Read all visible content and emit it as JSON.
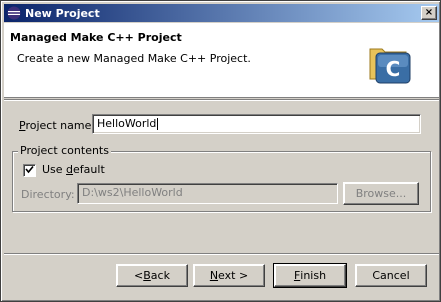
{
  "window": {
    "title": "New Project",
    "close_glyph": "×"
  },
  "header": {
    "title": "Managed Make C++ Project",
    "description": "Create a new Managed Make C++ Project.",
    "icon_letter": "C"
  },
  "form": {
    "project_name_label_u": "P",
    "project_name_label_rest": "roject name:",
    "project_name_value": "HelloWorld",
    "group_title": "Project contents",
    "use_default_checked": true,
    "use_default_label_pre": "Use ",
    "use_default_label_u": "d",
    "use_default_label_rest": "efault",
    "directory_label_pre": "Directory: ",
    "directory_value": "D:\\ws2\\HelloWorld",
    "browse_label": "Browse..."
  },
  "buttons": {
    "back_pre": "< ",
    "back_u": "B",
    "back_rest": "ack",
    "next_u": "N",
    "next_rest": "ext >",
    "finish_u": "F",
    "finish_rest": "inish",
    "cancel": "Cancel"
  },
  "colors": {
    "title_gradient_start": "#0a246a",
    "title_gradient_end": "#a6caf0",
    "dialog_bg": "#d4d0c8",
    "header_bg": "#ffffff",
    "icon_blue": "#3a6ea5"
  },
  "icons": {
    "app": "eclipse-icon",
    "wizard": "cpp-project-icon",
    "check": "checkmark-icon"
  }
}
